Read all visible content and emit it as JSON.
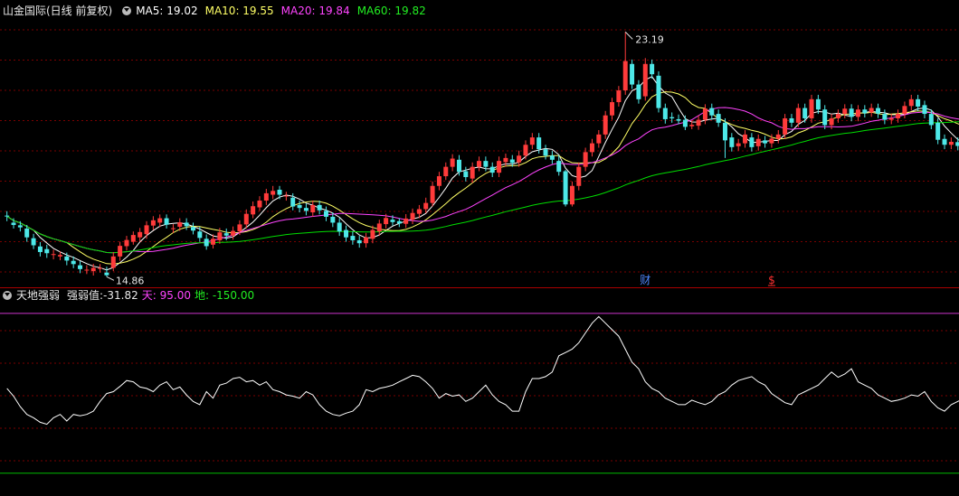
{
  "header": {
    "title": "山金国际(日线 前复权)",
    "ma5": "MA5: 19.02",
    "ma10": "MA10: 19.55",
    "ma20": "MA20: 19.84",
    "ma60": "MA60: 19.82"
  },
  "indicator_header": {
    "name": "天地强弱",
    "value_label": "强弱值:-31.82",
    "sky_label": "天: 95.00",
    "ground_label": "地: -150.00"
  },
  "colors": {
    "up": "#ff3b3b",
    "down": "#4de8e8",
    "ma5": "#ffffff",
    "ma10": "#ffff66",
    "ma20": "#ff44ff",
    "ma60": "#00dd00",
    "grid": "#7a0000",
    "title": "#e8e8e8",
    "sky_line": "#cc33cc",
    "ground_line": "#00bb00"
  },
  "chart_data": [
    {
      "type": "candlestick",
      "title": "山金国际(日线 前复权)",
      "ylim": [
        14.5,
        23.6
      ],
      "annotations": [
        {
          "text": "23.19",
          "index": 93,
          "kind": "high"
        },
        {
          "text": "14.86",
          "index": 15,
          "kind": "low"
        },
        {
          "text": "财",
          "index": 96,
          "kind": "event",
          "color": "#4d88ff"
        },
        {
          "text": "$",
          "index": 115,
          "kind": "event",
          "color": "#ff3030"
        }
      ],
      "series_legend": [
        "MA5",
        "MA10",
        "MA20",
        "MA60"
      ],
      "ohlc": [
        [
          16.94,
          16.92,
          17.09,
          16.75
        ],
        [
          16.7,
          16.62,
          16.85,
          16.5
        ],
        [
          16.61,
          16.54,
          16.75,
          16.4
        ],
        [
          16.5,
          16.2,
          16.62,
          16.05
        ],
        [
          16.17,
          15.93,
          16.32,
          15.8
        ],
        [
          15.89,
          15.7,
          16.04,
          15.55
        ],
        [
          15.8,
          15.66,
          15.95,
          15.5
        ],
        [
          15.6,
          15.63,
          15.78,
          15.45
        ],
        [
          15.55,
          15.6,
          15.72,
          15.42
        ],
        [
          15.55,
          15.41,
          15.68,
          15.25
        ],
        [
          15.4,
          15.29,
          15.55,
          15.15
        ],
        [
          15.25,
          15.12,
          15.39,
          14.98
        ],
        [
          15.1,
          15.1,
          15.25,
          14.95
        ],
        [
          15.05,
          15.16,
          15.3,
          14.9
        ],
        [
          15.14,
          15.16,
          15.29,
          15.0
        ],
        [
          15.0,
          14.91,
          15.2,
          14.86
        ],
        [
          15.16,
          15.55,
          15.7,
          15.05
        ],
        [
          15.55,
          15.91,
          16.05,
          15.4
        ],
        [
          15.9,
          16.11,
          16.25,
          15.75
        ],
        [
          16.05,
          16.28,
          16.4,
          15.95
        ],
        [
          16.2,
          16.38,
          16.52,
          16.05
        ],
        [
          16.31,
          16.61,
          16.75,
          16.15
        ],
        [
          16.6,
          16.78,
          16.92,
          16.45
        ],
        [
          16.7,
          16.85,
          16.98,
          16.55
        ],
        [
          16.85,
          16.63,
          16.98,
          16.5
        ],
        [
          16.5,
          16.51,
          16.65,
          16.35
        ],
        [
          16.56,
          16.71,
          16.85,
          16.42
        ],
        [
          16.7,
          16.58,
          16.85,
          16.45
        ],
        [
          16.55,
          16.43,
          16.7,
          16.3
        ],
        [
          16.4,
          16.18,
          16.56,
          16.05
        ],
        [
          16.15,
          15.9,
          16.3,
          15.78
        ],
        [
          15.95,
          16.15,
          16.3,
          15.82
        ],
        [
          16.1,
          16.37,
          16.52,
          15.98
        ],
        [
          16.34,
          16.26,
          16.5,
          16.1
        ],
        [
          16.26,
          16.42,
          16.57,
          16.12
        ],
        [
          16.4,
          16.64,
          16.78,
          16.28
        ],
        [
          16.64,
          17.0,
          17.15,
          16.5
        ],
        [
          16.98,
          17.26,
          17.42,
          16.85
        ],
        [
          17.22,
          17.45,
          17.6,
          17.1
        ],
        [
          17.45,
          17.7,
          17.85,
          17.3
        ],
        [
          17.65,
          17.78,
          17.95,
          17.5
        ],
        [
          17.82,
          17.65,
          17.95,
          17.5
        ],
        [
          17.6,
          17.62,
          17.75,
          17.45
        ],
        [
          17.55,
          17.25,
          17.7,
          17.12
        ],
        [
          17.3,
          17.2,
          17.45,
          17.05
        ],
        [
          17.2,
          17.1,
          17.35,
          16.95
        ],
        [
          17.05,
          17.3,
          17.45,
          16.9
        ],
        [
          17.3,
          17.12,
          17.45,
          16.98
        ],
        [
          17.1,
          16.9,
          17.25,
          16.75
        ],
        [
          16.9,
          16.7,
          17.05,
          16.55
        ],
        [
          16.7,
          16.4,
          16.85,
          16.25
        ],
        [
          16.45,
          16.2,
          16.6,
          16.05
        ],
        [
          16.25,
          16.1,
          16.4,
          15.95
        ],
        [
          16.1,
          16.0,
          16.25,
          15.85
        ],
        [
          16.0,
          16.2,
          16.35,
          15.85
        ],
        [
          16.15,
          16.45,
          16.6,
          16.0
        ],
        [
          16.4,
          16.67,
          16.8,
          16.25
        ],
        [
          16.65,
          16.86,
          17.0,
          16.5
        ],
        [
          16.8,
          16.72,
          16.95,
          16.6
        ],
        [
          16.75,
          16.67,
          16.85,
          16.55
        ],
        [
          16.66,
          16.84,
          16.99,
          16.52
        ],
        [
          16.8,
          17.03,
          17.18,
          16.65
        ],
        [
          17.0,
          17.16,
          17.3,
          16.85
        ],
        [
          17.16,
          17.37,
          17.55,
          17.02
        ],
        [
          17.37,
          17.95,
          18.1,
          17.25
        ],
        [
          17.95,
          18.28,
          18.43,
          17.8
        ],
        [
          18.28,
          18.6,
          18.75,
          18.15
        ],
        [
          18.6,
          18.88,
          19.03,
          18.45
        ],
        [
          18.84,
          18.43,
          19.0,
          18.3
        ],
        [
          18.45,
          18.25,
          18.6,
          18.1
        ],
        [
          18.2,
          18.6,
          18.75,
          18.05
        ],
        [
          18.6,
          18.8,
          18.95,
          18.45
        ],
        [
          18.8,
          18.6,
          18.95,
          18.45
        ],
        [
          18.6,
          18.4,
          18.75,
          18.25
        ],
        [
          18.4,
          18.8,
          18.95,
          18.25
        ],
        [
          18.76,
          18.9,
          19.05,
          18.6
        ],
        [
          18.85,
          18.73,
          19.0,
          18.6
        ],
        [
          18.75,
          18.98,
          19.15,
          18.6
        ],
        [
          18.98,
          19.35,
          19.5,
          18.85
        ],
        [
          19.35,
          19.6,
          19.75,
          19.2
        ],
        [
          19.6,
          19.2,
          19.75,
          19.05
        ],
        [
          19.2,
          18.98,
          19.35,
          18.85
        ],
        [
          18.98,
          18.84,
          19.15,
          18.7
        ],
        [
          18.8,
          18.43,
          19.0,
          18.3
        ],
        [
          18.45,
          17.32,
          18.5,
          17.25
        ],
        [
          17.32,
          17.95,
          18.1,
          17.25
        ],
        [
          17.95,
          18.6,
          18.75,
          17.8
        ],
        [
          18.6,
          19.1,
          19.25,
          18.45
        ],
        [
          19.1,
          19.4,
          19.55,
          18.95
        ],
        [
          19.4,
          19.7,
          19.85,
          19.25
        ],
        [
          19.7,
          20.35,
          20.5,
          19.55
        ],
        [
          20.35,
          20.8,
          20.95,
          20.2
        ],
        [
          20.8,
          21.2,
          21.35,
          20.65
        ],
        [
          21.2,
          22.2,
          23.19,
          21.05
        ],
        [
          22.1,
          21.4,
          22.25,
          21.25
        ],
        [
          21.4,
          20.9,
          21.55,
          20.75
        ],
        [
          21.0,
          22.1,
          22.3,
          20.85
        ],
        [
          22.1,
          21.75,
          22.25,
          21.6
        ],
        [
          21.7,
          20.6,
          21.85,
          20.45
        ],
        [
          20.6,
          20.22,
          20.75,
          20.07
        ],
        [
          20.29,
          20.25,
          20.45,
          20.1
        ],
        [
          20.22,
          20.17,
          20.38,
          20.05
        ],
        [
          20.2,
          19.96,
          20.35,
          19.85
        ],
        [
          19.98,
          20.03,
          20.18,
          19.88
        ],
        [
          20.0,
          20.2,
          20.35,
          19.86
        ],
        [
          20.2,
          20.58,
          20.73,
          20.05
        ],
        [
          20.6,
          20.35,
          20.75,
          20.2
        ],
        [
          20.4,
          20.1,
          20.55,
          19.96
        ],
        [
          20.1,
          19.5,
          20.25,
          18.9
        ],
        [
          19.6,
          19.27,
          19.75,
          19.12
        ],
        [
          19.3,
          19.4,
          19.55,
          19.15
        ],
        [
          19.4,
          19.7,
          19.85,
          19.25
        ],
        [
          19.6,
          19.27,
          19.75,
          19.12
        ],
        [
          19.3,
          19.55,
          19.7,
          19.15
        ],
        [
          19.5,
          19.4,
          19.65,
          19.25
        ],
        [
          19.4,
          19.56,
          19.71,
          19.25
        ],
        [
          19.55,
          19.7,
          19.85,
          19.4
        ],
        [
          19.7,
          20.25,
          20.4,
          19.55
        ],
        [
          20.25,
          20.1,
          20.4,
          19.95
        ],
        [
          20.1,
          20.6,
          20.75,
          19.95
        ],
        [
          20.6,
          20.25,
          20.75,
          20.1
        ],
        [
          20.25,
          20.9,
          21.05,
          20.1
        ],
        [
          20.9,
          20.55,
          21.05,
          20.4
        ],
        [
          20.55,
          20.02,
          20.7,
          19.88
        ],
        [
          20.02,
          20.25,
          20.4,
          19.88
        ],
        [
          20.25,
          20.4,
          20.55,
          20.1
        ],
        [
          20.4,
          20.58,
          20.73,
          20.25
        ],
        [
          20.58,
          20.3,
          20.73,
          20.15
        ],
        [
          20.3,
          20.55,
          20.7,
          20.15
        ],
        [
          20.55,
          20.42,
          20.7,
          20.28
        ],
        [
          20.45,
          20.6,
          20.75,
          20.3
        ],
        [
          20.6,
          20.41,
          20.75,
          20.26
        ],
        [
          20.4,
          20.2,
          20.55,
          20.05
        ],
        [
          20.2,
          20.25,
          20.4,
          20.05
        ],
        [
          20.25,
          20.4,
          20.55,
          20.1
        ],
        [
          20.4,
          20.67,
          20.82,
          20.25
        ],
        [
          20.67,
          20.9,
          21.05,
          20.52
        ],
        [
          20.9,
          20.65,
          21.05,
          20.5
        ],
        [
          20.7,
          20.4,
          20.85,
          20.25
        ],
        [
          20.4,
          20.02,
          20.55,
          19.88
        ],
        [
          20.1,
          19.52,
          20.25,
          19.37
        ],
        [
          19.55,
          19.35,
          19.7,
          19.2
        ],
        [
          19.35,
          19.45,
          19.6,
          19.2
        ],
        [
          19.44,
          19.31,
          19.6,
          19.16
        ],
        [
          19.3,
          19.44,
          19.55,
          19.15
        ]
      ]
    },
    {
      "type": "line",
      "name": "强弱值",
      "ylim": [
        -185,
        110
      ],
      "reference_lines": [
        95,
        -150
      ],
      "values": [
        -20,
        -32,
        -48,
        -60,
        -65,
        -72,
        -75,
        -65,
        -60,
        -70,
        -60,
        -62,
        -60,
        -55,
        -40,
        -28,
        -25,
        -17,
        -8,
        -10,
        -18,
        -20,
        -25,
        -15,
        -10,
        -22,
        -18,
        -30,
        -40,
        -45,
        -25,
        -35,
        -15,
        -12,
        -5,
        -3,
        -10,
        -8,
        -15,
        -10,
        -22,
        -25,
        -30,
        -32,
        -35,
        -25,
        -30,
        -45,
        -55,
        -60,
        -62,
        -58,
        -55,
        -45,
        -22,
        -25,
        -20,
        -18,
        -15,
        -10,
        -5,
        0,
        -2,
        -10,
        -20,
        -35,
        -28,
        -32,
        -30,
        -40,
        -35,
        -25,
        -15,
        -30,
        -40,
        -45,
        -55,
        -55,
        -25,
        -5,
        -5,
        -2,
        5,
        30,
        35,
        40,
        50,
        65,
        80,
        90,
        80,
        70,
        60,
        40,
        20,
        10,
        -10,
        -20,
        -25,
        -35,
        -40,
        -45,
        -45,
        -38,
        -42,
        -45,
        -40,
        -30,
        -25,
        -15,
        -8,
        -5,
        -2,
        -10,
        -15,
        -28,
        -35,
        -42,
        -45,
        -30,
        -25,
        -20,
        -15,
        -5,
        5,
        -3,
        2,
        10,
        -10,
        -15,
        -20,
        -30,
        -35,
        -40,
        -38,
        -35,
        -30,
        -32,
        -25,
        -40,
        -50,
        -55,
        -45,
        -40,
        -35,
        -42,
        -45
      ]
    }
  ]
}
